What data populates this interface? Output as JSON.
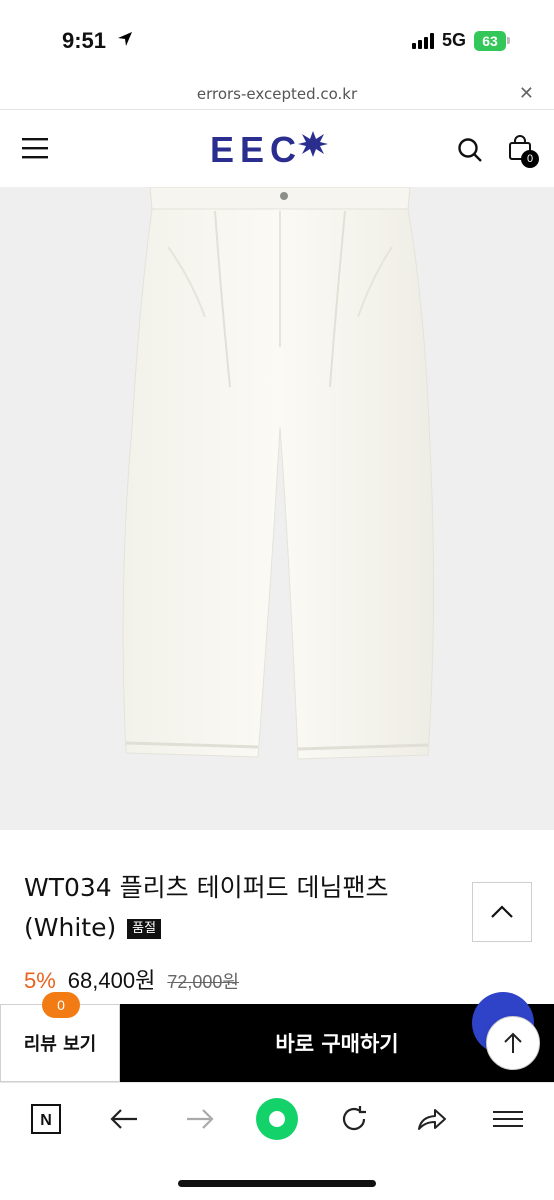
{
  "status_bar": {
    "time": "9:51",
    "network": "5G",
    "battery": "63"
  },
  "browser": {
    "url": "errors-excepted.co.kr",
    "close_icon": "close-icon"
  },
  "header": {
    "logo_text": "EEC",
    "brand_color": "#2a2f8f",
    "cart_count": "0"
  },
  "product": {
    "title": "WT034 플리츠 테이퍼드 데님팬츠 (White)",
    "soldout_badge": "품절",
    "discount": "5%",
    "price": "68,400원",
    "original_price": "72,000원",
    "discount_color": "#e8621f"
  },
  "actions": {
    "review_label": "리뷰 보기",
    "review_count": "0",
    "buy_label": "바로 구매하기"
  },
  "icons": {
    "menu": "hamburger-menu-icon",
    "search": "search-icon",
    "cart": "shopping-bag-icon",
    "collapse": "chevron-up-icon",
    "scroll_top": "arrow-up-icon",
    "naver": "naver-n-icon",
    "back": "arrow-left-icon",
    "forward": "arrow-right-icon",
    "green_dot": "naver-green-dot-icon",
    "reload": "reload-icon",
    "share": "share-icon",
    "more": "hamburger-icon"
  }
}
